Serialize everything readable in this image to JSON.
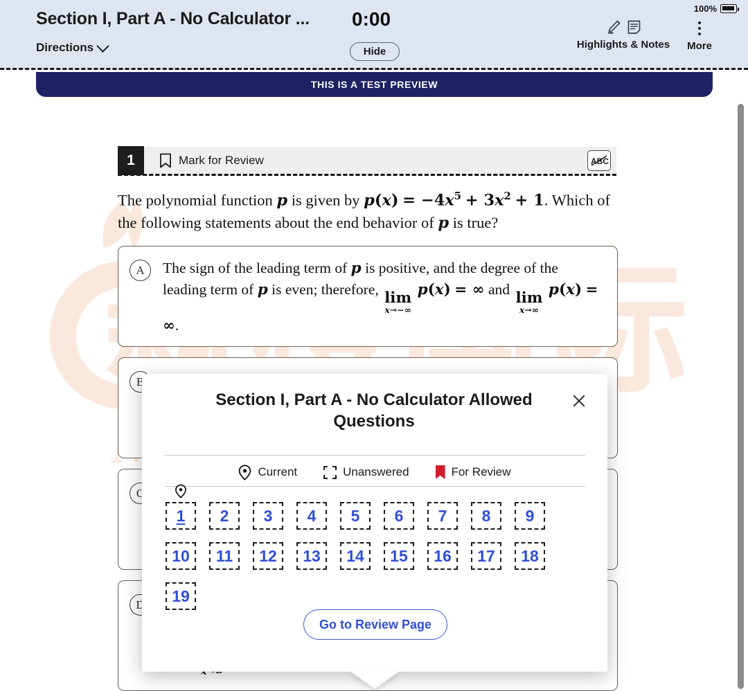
{
  "header": {
    "section_title": "Section I, Part A - No Calculator ...",
    "directions_label": "Directions",
    "timer": "0:00",
    "hide_label": "Hide",
    "highlights_notes_label": "Highlights & Notes",
    "more_label": "More",
    "battery_percent": "100%",
    "icons": {
      "chevron": "chevron-down-icon",
      "highlighter": "highlighter-pen-icon",
      "notes": "notes-page-icon",
      "more": "more-vertical-dots-icon",
      "battery": "battery-charging-icon"
    }
  },
  "preview_banner": {
    "text": "THIS IS A TEST PREVIEW"
  },
  "question": {
    "number": "1",
    "mark_for_review_label": "Mark for Review",
    "cross_out_tool_label": "ABC",
    "stem_lines": [
      "The polynomial function p is given by p(x) = -4x^5 + 3x^2 + 1. Which of",
      "the following statements about the end behavior of p is true?"
    ],
    "choices": [
      {
        "letter": "A",
        "text": "The sign of the leading term of p is positive, and the degree of the leading term of p is even; therefore, lim(x->-inf) p(x) = inf and lim(x->inf) p(x) = inf."
      },
      {
        "letter": "B",
        "text": ""
      },
      {
        "letter": "C",
        "text": ""
      },
      {
        "letter": "D",
        "text": ""
      }
    ]
  },
  "modal": {
    "title": "Section I, Part A - No Calculator Allowed Questions",
    "close_label": "Close",
    "legend": [
      {
        "icon": "map-pin-icon",
        "label": "Current"
      },
      {
        "icon": "dashed-square-icon",
        "label": "Unanswered"
      },
      {
        "icon": "bookmark-flag-icon",
        "label": "For Review"
      }
    ],
    "questions": [
      {
        "n": "1",
        "state": "current"
      },
      {
        "n": "2",
        "state": "unanswered"
      },
      {
        "n": "3",
        "state": "unanswered"
      },
      {
        "n": "4",
        "state": "unanswered"
      },
      {
        "n": "5",
        "state": "unanswered"
      },
      {
        "n": "6",
        "state": "unanswered"
      },
      {
        "n": "7",
        "state": "unanswered"
      },
      {
        "n": "8",
        "state": "unanswered"
      },
      {
        "n": "9",
        "state": "unanswered"
      },
      {
        "n": "10",
        "state": "unanswered"
      },
      {
        "n": "11",
        "state": "unanswered"
      },
      {
        "n": "12",
        "state": "unanswered"
      },
      {
        "n": "13",
        "state": "unanswered"
      },
      {
        "n": "14",
        "state": "unanswered"
      },
      {
        "n": "15",
        "state": "unanswered"
      },
      {
        "n": "16",
        "state": "unanswered"
      },
      {
        "n": "17",
        "state": "unanswered"
      },
      {
        "n": "18",
        "state": "unanswered"
      },
      {
        "n": "19",
        "state": "unanswered"
      }
    ],
    "review_button_label": "Go to Review Page"
  },
  "watermark": {
    "cjk_text": "新橙国际",
    "latin_text": "New Achievements",
    "color": "#fbe8dd"
  },
  "colors": {
    "header_bg": "#dfe5f0",
    "banner_bg": "#1e2263",
    "accent_blue": "#2f4fd8",
    "flag_red": "#cf1d2e",
    "question_num_bg": "#1d1d1d"
  }
}
